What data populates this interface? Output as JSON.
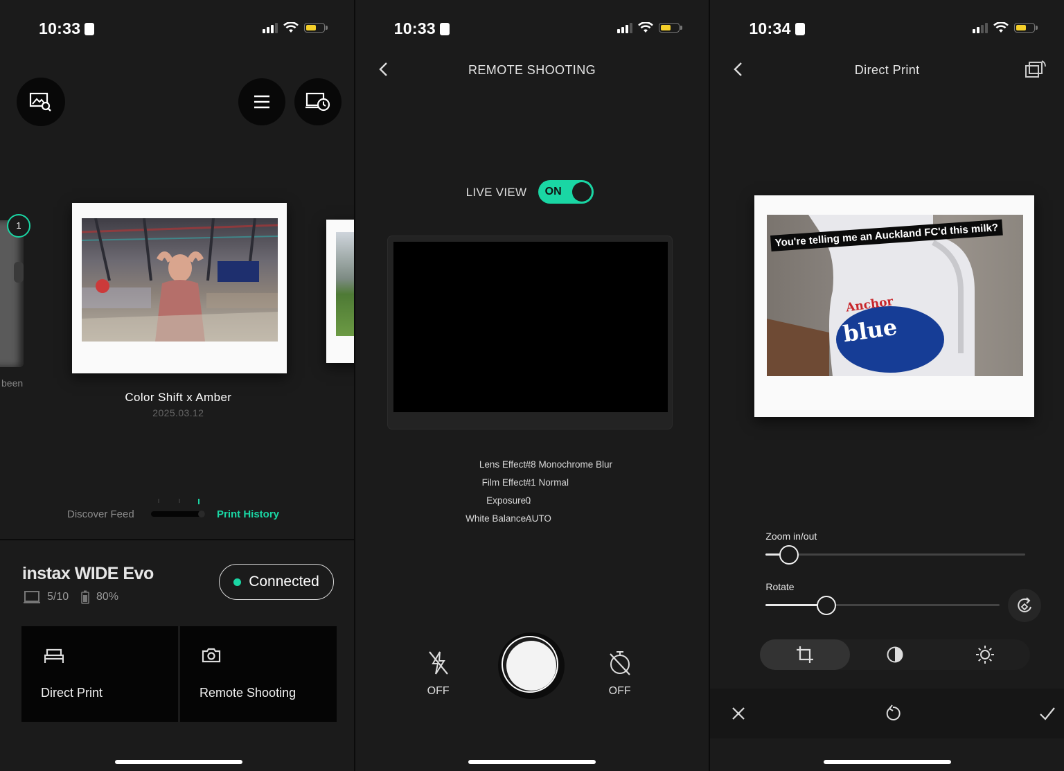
{
  "colors": {
    "accent": "#1ad6a4",
    "background": "#1b1b1b",
    "battery": "#f4cf2a"
  },
  "screen1": {
    "time": "10:33",
    "carousel_badge": "1",
    "left_peek_text": "been",
    "photo_title": "Color Shift x Amber",
    "photo_date": "2025.03.12",
    "feed_label": "Discover Feed",
    "history_label": "Print History",
    "device_name": "instax WIDE Evo",
    "film_count": "5/10",
    "battery_pct": "80%",
    "connection_status": "Connected",
    "actions": [
      {
        "label": "Direct Print",
        "icon": "printer-icon"
      },
      {
        "label": "Remote Shooting",
        "icon": "camera-icon"
      }
    ],
    "icons": [
      "image-search-icon",
      "menu-icon",
      "device-history-icon"
    ]
  },
  "screen2": {
    "time": "10:33",
    "title": "REMOTE SHOOTING",
    "live_view_label": "LIVE VIEW",
    "live_view_state": "ON",
    "settings": [
      {
        "key": "Lens Effect :",
        "value": "#8 Monochrome Blur"
      },
      {
        "key": "Film Effect :",
        "value": "#1 Normal"
      },
      {
        "key": "Exposure :",
        "value": "0"
      },
      {
        "key": "White Balance :",
        "value": "AUTO"
      }
    ],
    "flash_label": "OFF",
    "timer_label": "OFF",
    "icons": [
      "back-icon",
      "flash-off-icon",
      "shutter-button",
      "timer-off-icon"
    ]
  },
  "screen3": {
    "time": "10:34",
    "title": "Direct Print",
    "photo_caption": "You're telling me an Auckland FC'd this milk?",
    "bottle_brand": "Anchor",
    "bottle_label": "blue",
    "zoom_label": "Zoom in/out",
    "zoom_value": 0.09,
    "rotate_label": "Rotate",
    "rotate_value": 0.26,
    "icons": [
      "back-icon",
      "orientation-icon",
      "crop-icon",
      "contrast-icon",
      "brightness-icon",
      "rotate-icon",
      "close-icon",
      "reset-icon",
      "confirm-icon"
    ]
  }
}
